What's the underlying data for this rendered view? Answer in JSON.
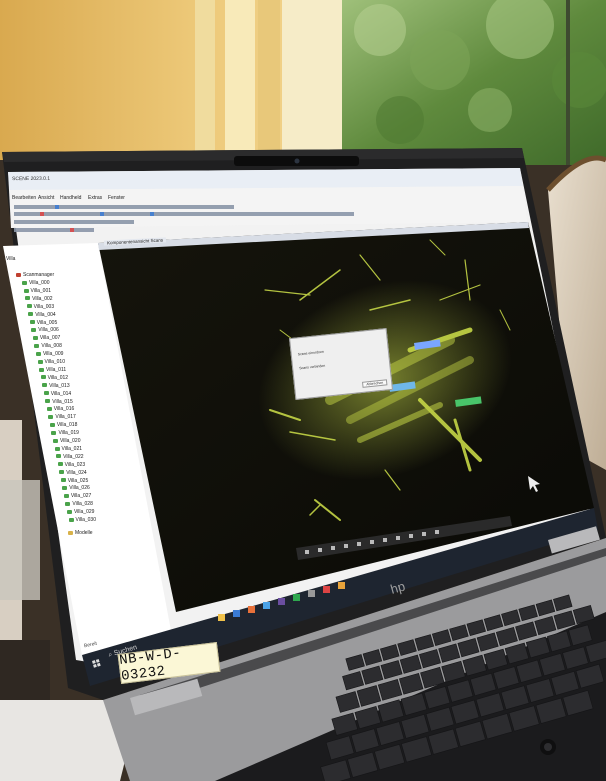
{
  "photo": {
    "laptop_brand": "hp",
    "asset_label": "NB-W-D-03232"
  },
  "app": {
    "title": "SCENE 2023.0.1",
    "menu": [
      "Bearbeiten",
      "Ansicht",
      "Handheld",
      "Extras",
      "Fenster"
    ],
    "tab": "Komponentenansicht Scans",
    "tree_root": "Villa",
    "tree_group": "Scanmanager",
    "tree_items": [
      "Villa_000",
      "Villa_001",
      "Villa_002",
      "Villa_003",
      "Villa_004",
      "Villa_005",
      "Villa_006",
      "Villa_007",
      "Villa_008",
      "Villa_009",
      "Villa_010",
      "Villa_011",
      "Villa_012",
      "Villa_013",
      "Villa_014",
      "Villa_015",
      "Villa_016",
      "Villa_017",
      "Villa_018",
      "Villa_019",
      "Villa_020",
      "Villa_021",
      "Villa_022",
      "Villa_023",
      "Villa_024",
      "Villa_025",
      "Villa_026",
      "Villa_027",
      "Villa_028",
      "Villa_029",
      "Villa_030"
    ],
    "tree_footer": "Modelle",
    "status_left": "Bereit",
    "dialog": {
      "line1": "Scans einordnen",
      "line2": "Scans verbinden",
      "button": "Abbrechen"
    }
  },
  "taskbar": {
    "search_label": "Suchen"
  },
  "colors": {
    "wall": "#e8c474",
    "window_frame": "#f3e6b8",
    "foliage": "#6f9a4c",
    "laptop_body": "#262626",
    "viewport_bg": "#111108",
    "point_cloud": "#c7d84a"
  }
}
